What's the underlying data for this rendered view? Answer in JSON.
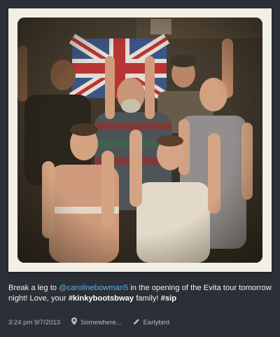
{
  "photo": {
    "alt_icon": "instagram-photo"
  },
  "caption": {
    "prefix": "Break a leg to ",
    "mention": "@carolinebowman5",
    "middle": " in the opening of the Evita tour tomorrow night! Love, your ",
    "hashtag1": "#kinkybootsbway",
    "middle2": " family! ",
    "hashtag2": "#sip"
  },
  "meta": {
    "datetime": "3:24 pm 9/7/2013",
    "location": "Somewhere...",
    "filter": "Earlybird",
    "location_icon": "map-pin-icon",
    "filter_icon": "pencil-icon"
  },
  "colors": {
    "background": "#2b2f36",
    "mention": "#58b3f0",
    "meta_text": "#b9bcc1",
    "frame": "#f1efe6"
  }
}
